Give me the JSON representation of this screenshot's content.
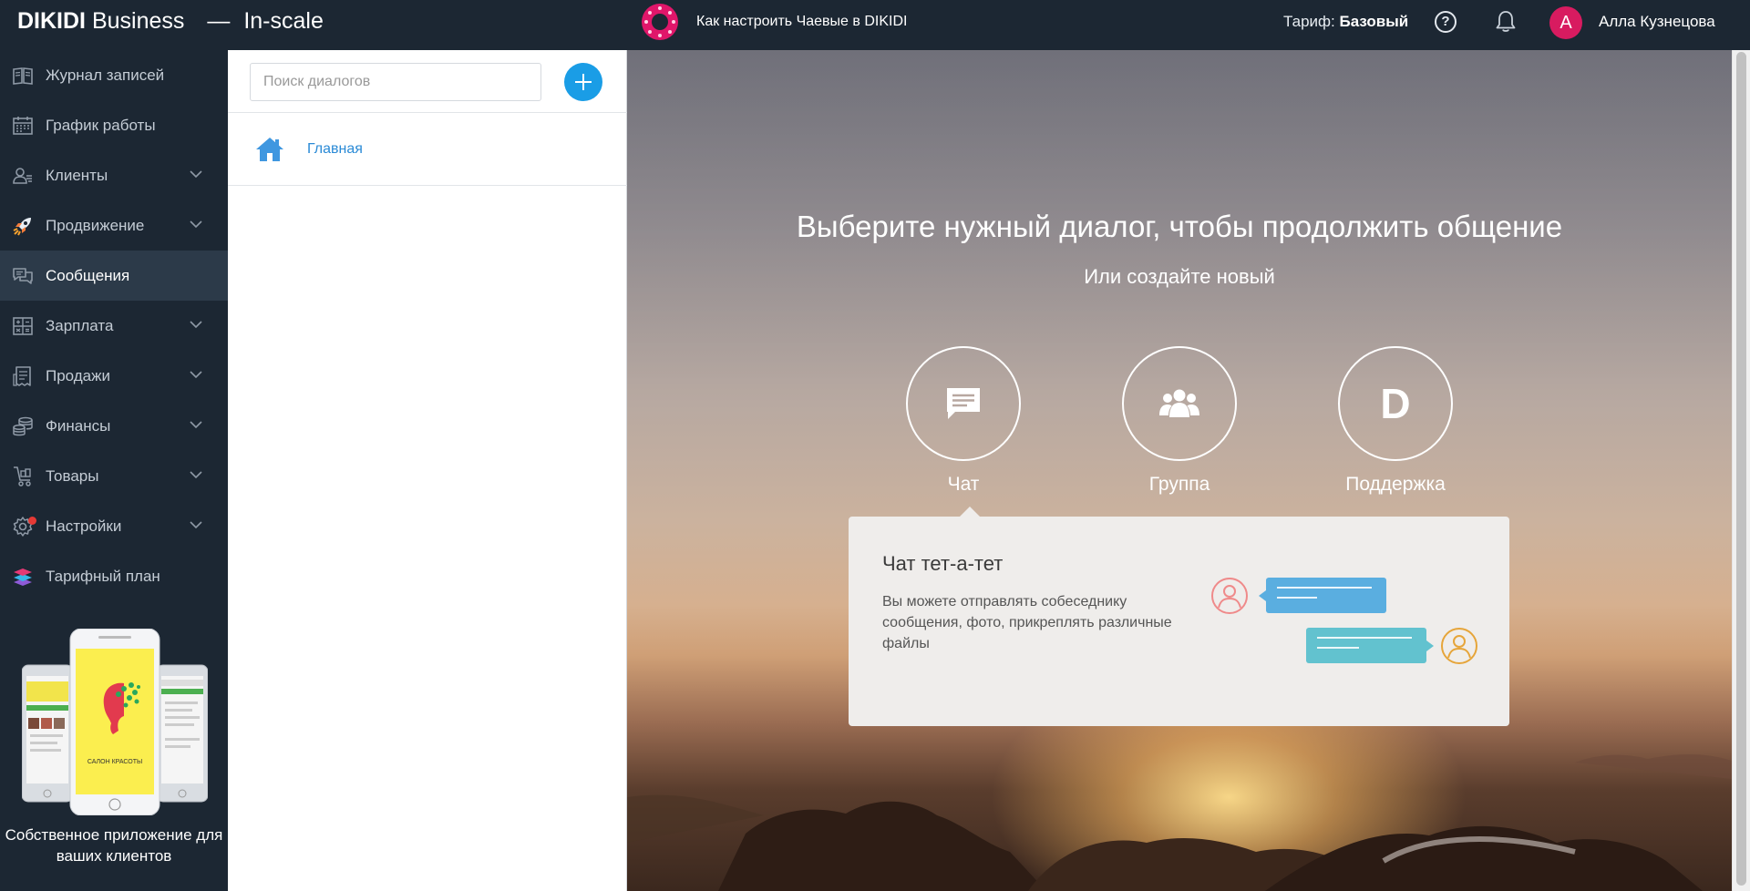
{
  "header": {
    "brand_name": "DIKIDI",
    "brand_suffix": "Business",
    "brand_dash": "—",
    "company": "In-scale",
    "promo_text": "Как настроить Чаевые в DIKIDI",
    "tariff_label": "Тариф:",
    "tariff_value": "Базовый",
    "help_symbol": "?",
    "avatar_letter": "А",
    "user_name": "Алла Кузнецова",
    "icons": [
      "help-icon",
      "bell-icon",
      "avatar"
    ]
  },
  "sidebar": {
    "items": [
      {
        "label": "Журнал записей",
        "icon": "journal-icon",
        "expandable": false
      },
      {
        "label": "График работы",
        "icon": "calendar-icon",
        "expandable": false
      },
      {
        "label": "Клиенты",
        "icon": "clients-icon",
        "expandable": true
      },
      {
        "label": "Продвижение",
        "icon": "rocket-icon",
        "expandable": true
      },
      {
        "label": "Сообщения",
        "icon": "messages-icon",
        "expandable": false,
        "active": true
      },
      {
        "label": "Зарплата",
        "icon": "salary-icon",
        "expandable": true
      },
      {
        "label": "Продажи",
        "icon": "sales-icon",
        "expandable": true
      },
      {
        "label": "Финансы",
        "icon": "coins-icon",
        "expandable": true
      },
      {
        "label": "Товары",
        "icon": "cart-icon",
        "expandable": true
      },
      {
        "label": "Настройки",
        "icon": "gear-icon",
        "expandable": true,
        "notification": true
      },
      {
        "label": "Тарифный план",
        "icon": "layers-icon",
        "expandable": false
      }
    ],
    "app_promo": {
      "caption": "Собственное приложение для ваших клиентов",
      "screen_text": "САЛОН КРАСОТЫ"
    }
  },
  "dialogs": {
    "search_placeholder": "Поиск диалогов",
    "search_value": "",
    "items": [
      {
        "label": "Главная",
        "icon": "home-icon"
      }
    ]
  },
  "main": {
    "title": "Выберите нужный диалог, чтобы продолжить общение",
    "subtitle": "Или создайте новый",
    "dialog_types": [
      {
        "label": "Чат",
        "icon": "chat-icon"
      },
      {
        "label": "Группа",
        "icon": "group-icon"
      },
      {
        "label": "Поддержка",
        "icon": "dikidi-d-icon",
        "letter": "D"
      }
    ],
    "info": {
      "title": "Чат тет-а-тет",
      "description": "Вы можете отправлять собеседнику сообщения, фото, прикреплять различные файлы"
    }
  },
  "colors": {
    "header_bg": "#1c2733",
    "sidebar_active_bg": "#2c3a49",
    "accent_blue": "#1a9de6",
    "link_blue": "#2a8ad6",
    "avatar_pink": "#d81b60",
    "bubble_blue": "#5aaee0",
    "bubble_teal": "#62c2cf",
    "person_pink": "#ef8a8a",
    "person_gold": "#e6a53a"
  }
}
